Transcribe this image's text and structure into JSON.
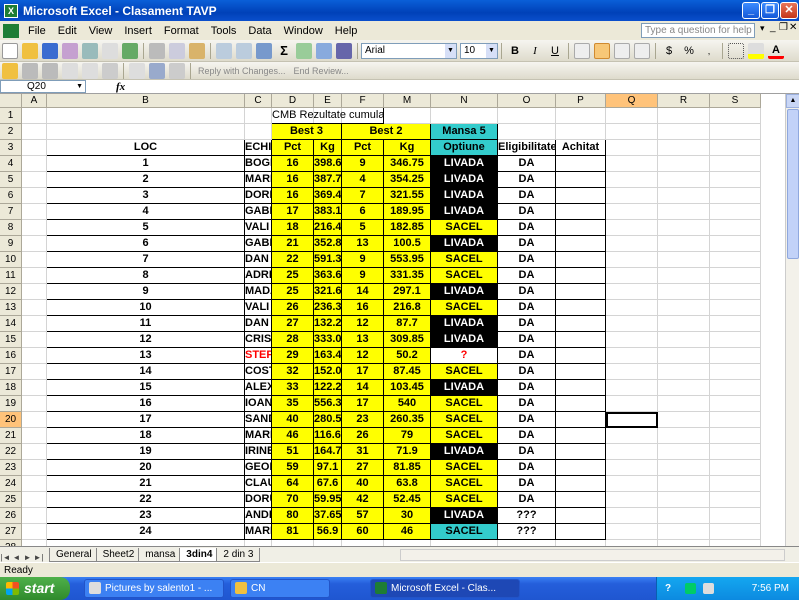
{
  "window": {
    "title": "Microsoft Excel - Clasament TAVP"
  },
  "menu": [
    "File",
    "Edit",
    "View",
    "Insert",
    "Format",
    "Tools",
    "Data",
    "Window",
    "Help"
  ],
  "menu_underline": [
    "F",
    "E",
    "V",
    "I",
    "o",
    "T",
    "D",
    "W",
    "H"
  ],
  "help_box": {
    "placeholder": "Type a question for help"
  },
  "formatting": {
    "font": "Arial",
    "size": "10"
  },
  "review_bar": {
    "reply": "Reply with Changes...",
    "end_review": "End Review..."
  },
  "formula_bar": {
    "name_box": "Q20",
    "fx": "fx",
    "content": ""
  },
  "columns": [
    "A",
    "B",
    "C",
    "D",
    "E",
    "F",
    "M",
    "N",
    "O",
    "P",
    "Q",
    "R",
    "S"
  ],
  "selected": {
    "column": "Q",
    "row": 20
  },
  "header": {
    "title": "CMB Rezultate cumulate",
    "best3": "Best 3",
    "best2": "Best 2",
    "mansa5": "Mansa 5",
    "loc": "LOC",
    "echipa": "ECHIPA",
    "pct": "Pct",
    "kg": "Kg",
    "optiune": "Optiune",
    "eligibilitate": "Eligibilitate",
    "achitat": "Achitat"
  },
  "rows": [
    {
      "loc": "1",
      "echipa": "BOGDAN DRAGAN -MIHAI PRIPON",
      "p3": "16",
      "k3": "398.6",
      "p2": "9",
      "k2": "346.75",
      "opt": "LIVADA",
      "elig": "DA"
    },
    {
      "loc": "2",
      "echipa": "MARIUS BARBU -MARIUS DIN",
      "p3": "16",
      "k3": "387.7",
      "p2": "4",
      "k2": "354.25",
      "opt": "LIVADA",
      "elig": "DA"
    },
    {
      "loc": "3",
      "echipa": "DORIN FARCAS -CRISTIAN BOLBOACA",
      "p3": "16",
      "k3": "369.4",
      "p2": "7",
      "k2": "321.55",
      "opt": "LIVADA",
      "elig": "DA"
    },
    {
      "loc": "4",
      "echipa": "GABI TOMULESCU - MIHAI STANESCU",
      "p3": "17",
      "k3": "383.1",
      "p2": "6",
      "k2": "189.95",
      "opt": "LIVADA",
      "elig": "DA"
    },
    {
      "loc": "5",
      "echipa": "VALI MARTOIU -CIPRIAN DOCHIA",
      "p3": "18",
      "k3": "216.4",
      "p2": "5",
      "k2": "182.85",
      "opt": "SACEL",
      "elig": "DA"
    },
    {
      "loc": "6",
      "echipa": "GABI SANDU –DAN DOCHIA",
      "p3": "21",
      "k3": "352.85",
      "p2": "13",
      "k2": "100.5",
      "opt": "LIVADA",
      "elig": "DA"
    },
    {
      "loc": "7",
      "echipa": "DAN MITRANESCU -VASILE IVAN",
      "p3": "22",
      "k3": "591.35",
      "p2": "9",
      "k2": "553.95",
      "opt": "SACEL",
      "elig": "DA"
    },
    {
      "loc": "8",
      "echipa": "ADRIAN DULAU -MIRCEA EPURE",
      "p3": "25",
      "k3": "363.6",
      "p2": "9",
      "k2": "331.35",
      "opt": "SACEL",
      "elig": "DA"
    },
    {
      "loc": "9",
      "echipa": "MADALIN BARNEA -IONESCU IONEL",
      "p3": "25",
      "k3": "321.6",
      "p2": "14",
      "k2": "297.1",
      "opt": "LIVADA",
      "elig": "DA"
    },
    {
      "loc": "10",
      "echipa": "VALI DUMITRU– GABRIEL STANCIU",
      "p3": "26",
      "k3": "236.3",
      "p2": "16",
      "k2": "216.8",
      "opt": "SACEL",
      "elig": "DA"
    },
    {
      "loc": "11",
      "echipa": "DAN MARINESCU – EDUARD GRIGORE",
      "p3": "27",
      "k3": "132.2",
      "p2": "12",
      "k2": "87.7",
      "opt": "LIVADA",
      "elig": "DA"
    },
    {
      "loc": "12",
      "echipa": "CRISTIAN BALAS -NICUSOR LAZURAN",
      "p3": "28",
      "k3": "333.05",
      "p2": "13",
      "k2": "309.85",
      "opt": "LIVADA",
      "elig": "DA"
    },
    {
      "loc": "13",
      "echipa": "STEFAN BABITA– GABRIEL CALIN",
      "p3": "29",
      "k3": "163.4",
      "p2": "12",
      "k2": "50.2",
      "opt": "?",
      "elig": "DA",
      "red": true
    },
    {
      "loc": "14",
      "echipa": "COSTICA EMILIAN -DINU SORIN",
      "p3": "32",
      "k3": "152.05",
      "p2": "17",
      "k2": "87.45",
      "opt": "SACEL",
      "elig": "DA"
    },
    {
      "loc": "15",
      "echipa": "ALEX JUREBIE- RAZVAN ULMEANU",
      "p3": "33",
      "k3": "122.2",
      "p2": "14",
      "k2": "103.45",
      "opt": "LIVADA",
      "elig": "DA"
    },
    {
      "loc": "16",
      "echipa": "IOAN NITU– MARIUS CIRA",
      "p3": "35",
      "k3": "556.35",
      "p2": "17",
      "k2": "540",
      "opt": "SACEL",
      "elig": "DA"
    },
    {
      "loc": "17",
      "echipa": "SANDU PODARU -CIPRIAN LEPADATU",
      "p3": "40",
      "k3": "280.55",
      "p2": "23",
      "k2": "260.35",
      "opt": "SACEL",
      "elig": "DA"
    },
    {
      "loc": "18",
      "echipa": "MARIAN CONSTANTIN- DAN MARINITA",
      "p3": "46",
      "k3": "116.65",
      "p2": "26",
      "k2": "79",
      "opt": "SACEL",
      "elig": "DA"
    },
    {
      "loc": "19",
      "echipa": "IRINEL BUNICA– LAURENTIU MARIN",
      "p3": "51",
      "k3": "164.7",
      "p2": "31",
      "k2": "71.9",
      "opt": "LIVADA",
      "elig": "DA"
    },
    {
      "loc": "20",
      "echipa": "GEORGE ALEXANDRU -PETRE IULIAN",
      "p3": "59",
      "k3": "97.1",
      "p2": "27",
      "k2": "81.85",
      "opt": "SACEL",
      "elig": "DA"
    },
    {
      "loc": "21",
      "echipa": "CLAUDIU COSMA- IOAN ADRIAN",
      "p3": "64",
      "k3": "67.6",
      "p2": "40",
      "k2": "63.8",
      "opt": "SACEL",
      "elig": "DA"
    },
    {
      "loc": "22",
      "echipa": "DORU MAILAT -CIPRIAN FLOROIU",
      "p3": "70",
      "k3": "59.95",
      "p2": "42",
      "k2": "52.45",
      "opt": "SACEL",
      "elig": "DA"
    },
    {
      "loc": "23",
      "echipa": "ANDREI GURAN–CATALIN LUCA",
      "p3": "80",
      "k3": "37.65",
      "p2": "57",
      "k2": "30",
      "opt": "LIVADA",
      "elig": "???"
    },
    {
      "loc": "24",
      "echipa": "MARIUS CIPCIGAN -CLAUDIU CIPCIGAN",
      "p3": "81",
      "k3": "56.9",
      "p2": "60",
      "k2": "46",
      "opt": "SACEL",
      "elig": "???",
      "cyan": true
    }
  ],
  "sheet_tabs": [
    "General",
    "Sheet2",
    "mansa",
    "3din4",
    "2 din 3"
  ],
  "active_tab": "3din4",
  "status": "Ready",
  "taskbar": {
    "start": "start",
    "items": [
      "Pictures by salento1 - ...",
      "CN",
      "Microsoft Excel - Clas..."
    ],
    "clock": "7:56 PM"
  },
  "colors": {
    "yellow": "#ffff00",
    "cyan": "#33cccc",
    "black": "#000000",
    "red": "#ff0000"
  }
}
